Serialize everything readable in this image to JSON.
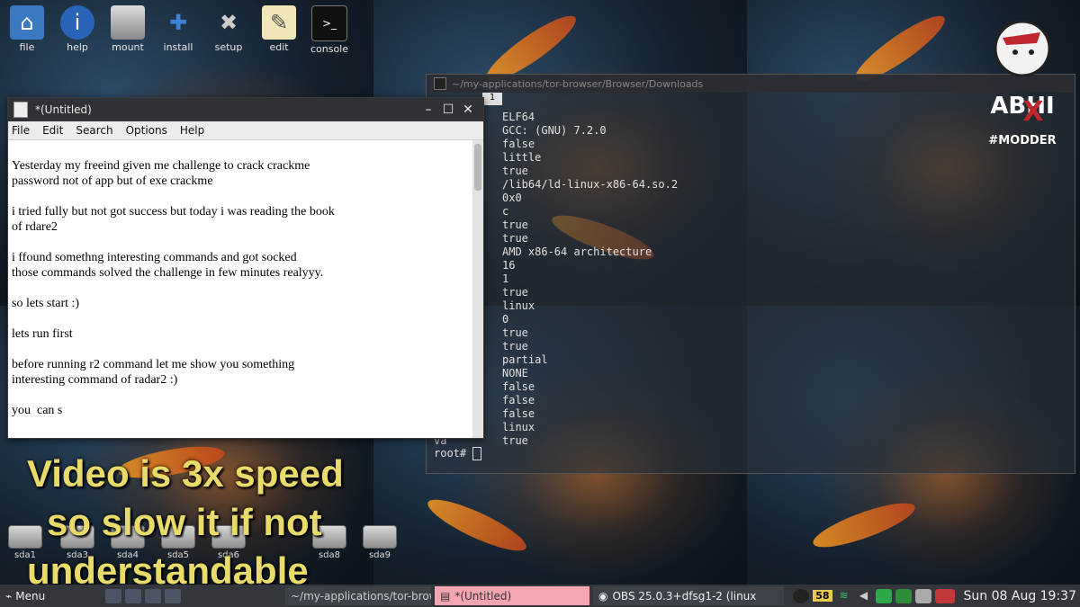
{
  "desktop": {
    "top_icons": [
      {
        "label": "file",
        "icon": "home-icon"
      },
      {
        "label": "help",
        "icon": "info-icon"
      },
      {
        "label": "mount",
        "icon": "drive-icon"
      },
      {
        "label": "install",
        "icon": "install-icon"
      },
      {
        "label": "setup",
        "icon": "tools-icon"
      },
      {
        "label": "edit",
        "icon": "edit-icon"
      },
      {
        "label": "console",
        "icon": "terminal-icon"
      }
    ],
    "drives": [
      "sda1",
      "sda3",
      "sda4",
      "sda5",
      "sda6",
      "sda8",
      "sda9"
    ]
  },
  "editor": {
    "title": "*(Untitled)",
    "menu": [
      "File",
      "Edit",
      "Search",
      "Options",
      "Help"
    ],
    "paragraphs": [
      "Yesterday my freeind given me challenge to crack crackme\npassword not of app but of exe crackme",
      "i tried fully but not got success but today i was reading the book\nof rdare2",
      "i ffound somethng interesting commands and got socked\nthose commands solved the challenge in few minutes realyyy.",
      "so lets start :)",
      "lets run first",
      "before running r2 command let me show you something\ninteresting command of radar2 :)",
      "you  can s"
    ]
  },
  "terminal": {
    "title": "~/my-applications/tor-browser/Browser/Downloads",
    "tab": "1",
    "rows": [
      {
        "k": "",
        "v": "ELF64"
      },
      {
        "k": "er",
        "v": "GCC: (GNU) 7.2.0"
      },
      {
        "k": "",
        "v": "false"
      },
      {
        "k": "",
        "v": "little"
      },
      {
        "k": "de",
        "v": "true"
      },
      {
        "k": "",
        "v": "/lib64/ld-linux-x86-64.so.2"
      },
      {
        "k": "",
        "v": "0x0"
      },
      {
        "k": "",
        "v": "c"
      },
      {
        "k": "m",
        "v": "true"
      },
      {
        "k": "",
        "v": "true"
      },
      {
        "k": "e",
        "v": "AMD x86-64 architecture"
      },
      {
        "k": "z",
        "v": "16"
      },
      {
        "k": "z",
        "v": "1"
      },
      {
        "k": "",
        "v": "true"
      },
      {
        "k": "",
        "v": "linux"
      },
      {
        "k": "n",
        "v": "0"
      },
      {
        "k": "",
        "v": "true"
      },
      {
        "k": "",
        "v": "true"
      },
      {
        "k": "",
        "v": "partial"
      },
      {
        "k": "",
        "v": "NONE"
      },
      {
        "k": "z",
        "v": "false"
      },
      {
        "k": "",
        "v": "false"
      },
      {
        "k": "ed",
        "v": "false"
      },
      {
        "k": "",
        "v": "linux"
      },
      {
        "k": "va",
        "v": "true"
      }
    ],
    "prompt": "root#"
  },
  "caption": {
    "line1": "Video is 3x speed",
    "line2": "so slow it if not",
    "line3": "understandable"
  },
  "taskbar": {
    "menu_label": "Menu",
    "tasks": [
      "~/my-applications/tor-brow",
      "*(Untitled)",
      "OBS 25.0.3+dfsg1-2 (linux"
    ],
    "badge": "58",
    "clock": "Sun 08 Aug 19:37"
  }
}
